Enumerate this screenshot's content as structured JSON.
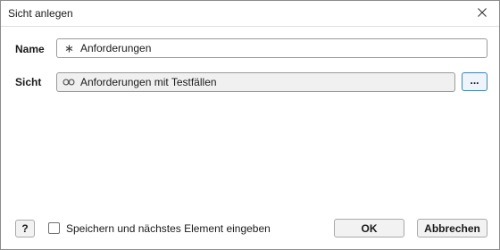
{
  "window": {
    "title": "Sicht anlegen",
    "close_icon": "close-icon"
  },
  "form": {
    "name": {
      "label": "Name",
      "value": "Anforderungen",
      "icon": "asterisk-icon"
    },
    "view": {
      "label": "Sicht",
      "value": "Anforderungen mit Testfällen",
      "icon": "link-icon",
      "browse_label": "..."
    }
  },
  "footer": {
    "help_label": "?",
    "checkbox_label": "Speichern und nächstes Element eingeben",
    "checkbox_checked": false,
    "ok_label": "OK",
    "cancel_label": "Abbrechen"
  },
  "colors": {
    "accent_border": "#3c86b8",
    "readonly_field_bg": "#f0f0f0"
  }
}
